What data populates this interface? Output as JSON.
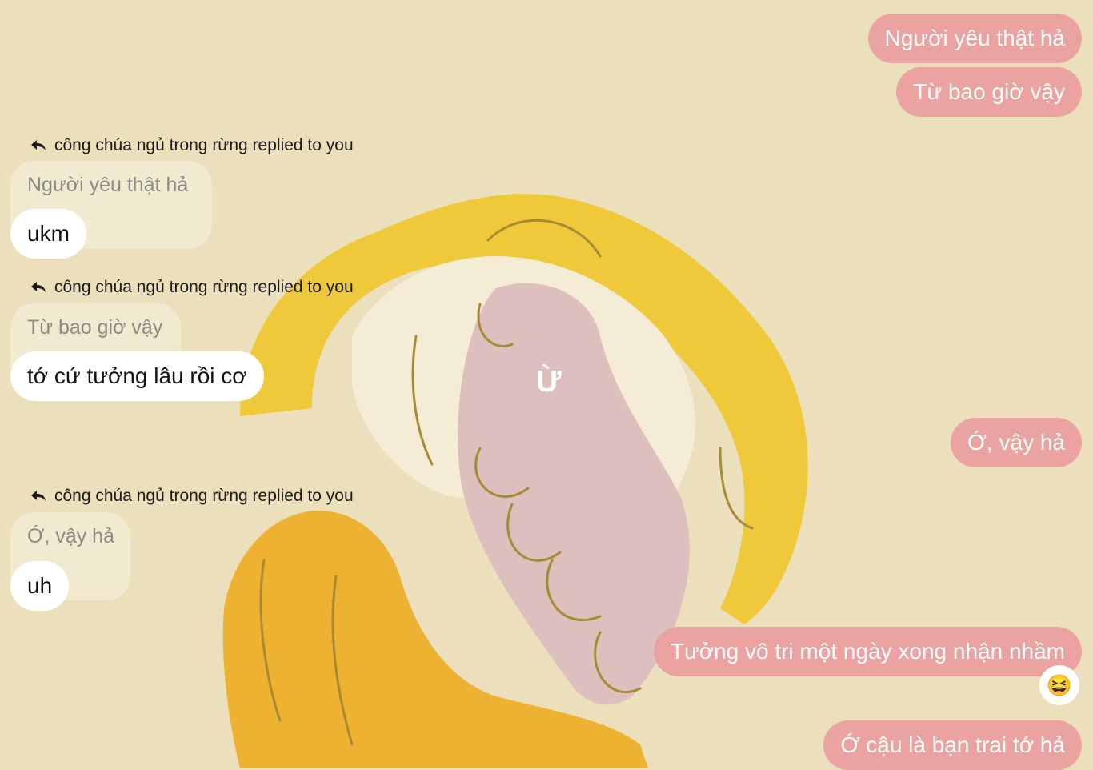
{
  "background_text": "Ừ",
  "sent_messages": [
    "Người yêu thật hả",
    "Từ bao giờ vậy",
    "Ớ, vậy hả",
    "Tưởng vô tri một ngày xong nhận nhầm",
    "Ớ cậu là bạn trai tớ hả"
  ],
  "replies": [
    {
      "reply_label": "công chúa ngủ trong rừng replied to you",
      "quoted": "Người yêu thật hả",
      "message": "ukm"
    },
    {
      "reply_label": "công chúa ngủ trong rừng replied to you",
      "quoted": "Từ bao giờ vậy",
      "message": "tớ cứ tưởng lâu rồi cơ"
    },
    {
      "reply_label": "công chúa ngủ trong rừng replied to you",
      "quoted": "Ớ, vậy hả",
      "message": "uh"
    }
  ],
  "reaction_emoji": "😆",
  "colors": {
    "background": "#ebe0bb",
    "sent_bubble": "#eaa3a0",
    "received_bubble": "#ffffff",
    "quoted_bubble": "#f1ead0"
  },
  "icons": {
    "reply": "reply-arrow-icon"
  }
}
